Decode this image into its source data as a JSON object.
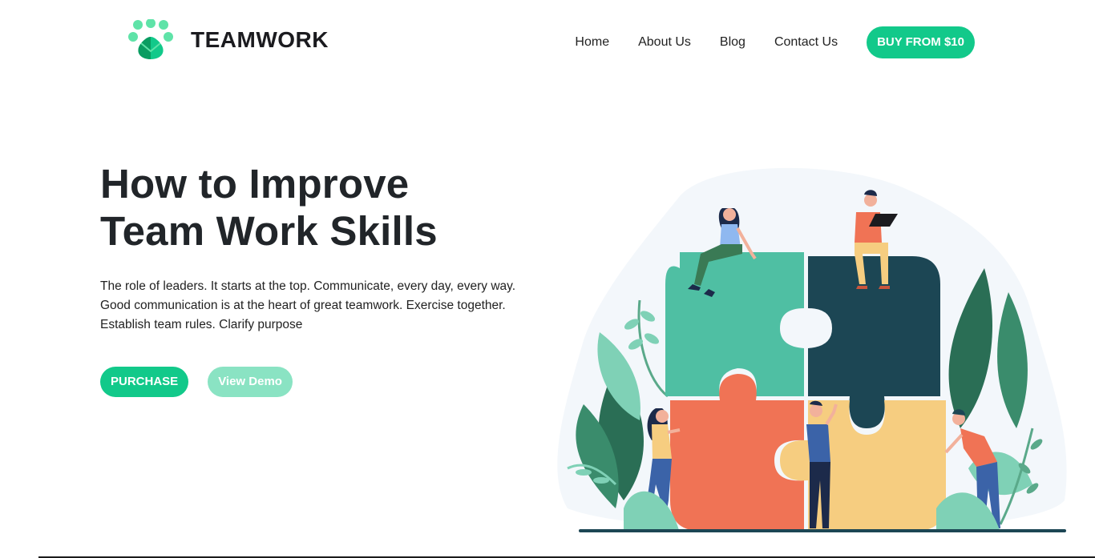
{
  "brand": {
    "name": "TEAMWORK",
    "logo_icon": "paw-icon",
    "logo_colors": [
      "#5fe3a8",
      "#12c98a",
      "#0a9c61"
    ]
  },
  "nav": {
    "items": [
      {
        "label": "Home"
      },
      {
        "label": "About Us"
      },
      {
        "label": "Blog"
      },
      {
        "label": "Contact Us"
      }
    ],
    "cta_label": "BUY FROM $10"
  },
  "hero": {
    "title_line1": "How to Improve",
    "title_line2": "Team Work Skills",
    "description": "The role of leaders. It starts at the top. Communicate, every day, every way. Good communication is at the heart of great teamwork. Exercise together. Establish team rules. Clarify purpose",
    "primary_button": "PURCHASE",
    "secondary_button": "View Demo"
  },
  "illustration": {
    "subject": "team-puzzle-illustration",
    "colors": {
      "teal": "#4fbfa3",
      "navy": "#1c4654",
      "coral": "#f07355",
      "yellow": "#f6cd80",
      "leaf_dark": "#2a6e55",
      "leaf_light": "#7fd1b6",
      "bg_blob": "#f3f7fb"
    }
  },
  "theme": {
    "accent": "#12c98a",
    "accent_light": "#8ae3c3",
    "text": "#212529"
  }
}
